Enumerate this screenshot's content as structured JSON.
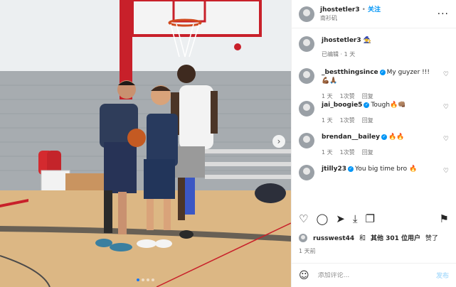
{
  "colors": {
    "accent": "#0095f6",
    "text": "#262626",
    "muted": "#737373"
  },
  "photo": {
    "carousel_index": 1,
    "carousel_count": 4
  },
  "header": {
    "username": "jhostetler3",
    "follow": "关注",
    "location": "南衫矶"
  },
  "caption": {
    "username": "jhostetler3",
    "emoji": "🧙",
    "edited": "已编辑 · 1 天"
  },
  "comments": [
    {
      "username": "_bestthingsince",
      "text": "My guyzer !!! 💪🏾🙏🏾",
      "time": "1 天",
      "likes": "1次赞",
      "reply": "回复"
    },
    {
      "username": "jai_boogie5",
      "text": "Tough🔥👊🏽",
      "time": "1 天",
      "likes": "1次赞",
      "reply": "回复"
    },
    {
      "username": "brendan__bailey",
      "text": "🔥🔥",
      "time": "1 天",
      "likes": "1次赞",
      "reply": "回复"
    },
    {
      "username": "jtilly23",
      "text": "You big time bro 🔥",
      "time": "",
      "likes": "",
      "reply": ""
    }
  ],
  "actions": {
    "icons": [
      "heart-icon",
      "comment-icon",
      "share-icon",
      "download-icon",
      "copy-icon",
      "bookmark-icon"
    ]
  },
  "likes": {
    "first_user": "russwest44",
    "and": "和",
    "others": "其他 301 位用户",
    "suffix": "赞了"
  },
  "time_ago": "1 天前",
  "add_comment": {
    "placeholder": "添加评论...",
    "post": "发布"
  }
}
